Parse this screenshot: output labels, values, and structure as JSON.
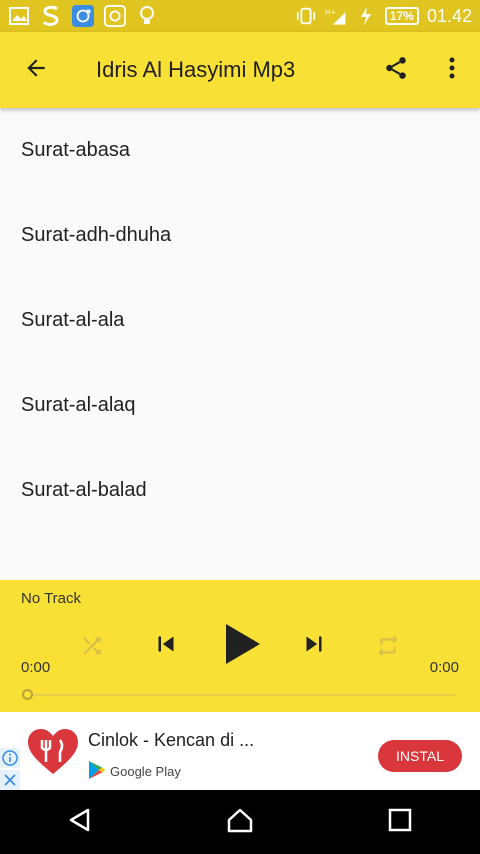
{
  "status_bar": {
    "battery": "17%",
    "time": "01.42",
    "network": "H+"
  },
  "appbar": {
    "title": "Idris Al Hasyimi Mp3"
  },
  "tracks": [
    {
      "label": "Surat-abasa"
    },
    {
      "label": "Surat-adh-dhuha"
    },
    {
      "label": "Surat-al-ala"
    },
    {
      "label": "Surat-al-alaq"
    },
    {
      "label": "Surat-al-balad"
    }
  ],
  "player": {
    "now_playing": "No Track",
    "elapsed": "0:00",
    "duration": "0:00",
    "progress": 0
  },
  "ad": {
    "title": "Cinlok - Kencan di ...",
    "store": "Google Play",
    "install_label": "INSTAL"
  },
  "colors": {
    "status_bar": "#e0c41f",
    "appbar": "#f8e035",
    "player": "#f8e035",
    "ad_button": "#d9373c"
  },
  "icons": {
    "back": "arrow-left-icon",
    "share": "share-icon",
    "more": "more-vert-icon",
    "shuffle": "shuffle-icon",
    "prev": "skip-previous-icon",
    "play": "play-icon",
    "next": "skip-next-icon",
    "repeat": "repeat-icon"
  }
}
